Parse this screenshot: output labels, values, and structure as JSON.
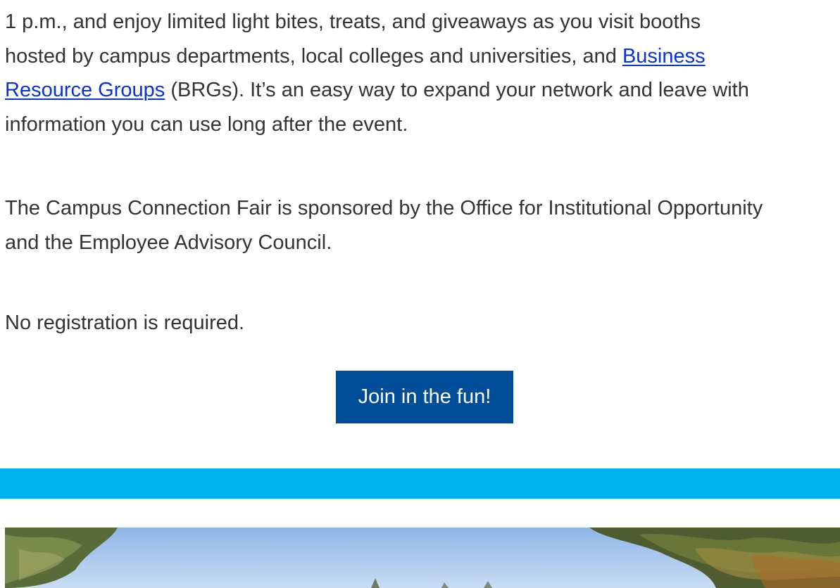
{
  "intro": {
    "line_1": "1 p.m., and enjoy limited light bites, treats, and giveaways as you visit booths",
    "line_2_before_link": "hosted by campus departments, local colleges and universities, and ",
    "brg_link_part_1": "Business",
    "brg_link_part_2": "Resource Groups",
    "line_3_after_link": " (BRGs). It’s an easy way to expand your network and leave with",
    "line_4": "information you can use long after the event."
  },
  "sponsor": {
    "line_1": "The Campus Connection Fair is sponsored by the Office for Institutional Opportunity",
    "line_2": "and the Employee Advisory Council."
  },
  "registration": {
    "text": "No registration is required."
  },
  "cta": {
    "label": "Join in the fun!"
  },
  "colors": {
    "body_text": "#333333",
    "link": "#0a33d6",
    "button_bg": "#004e9a",
    "divider_bar": "#00b2ec"
  }
}
